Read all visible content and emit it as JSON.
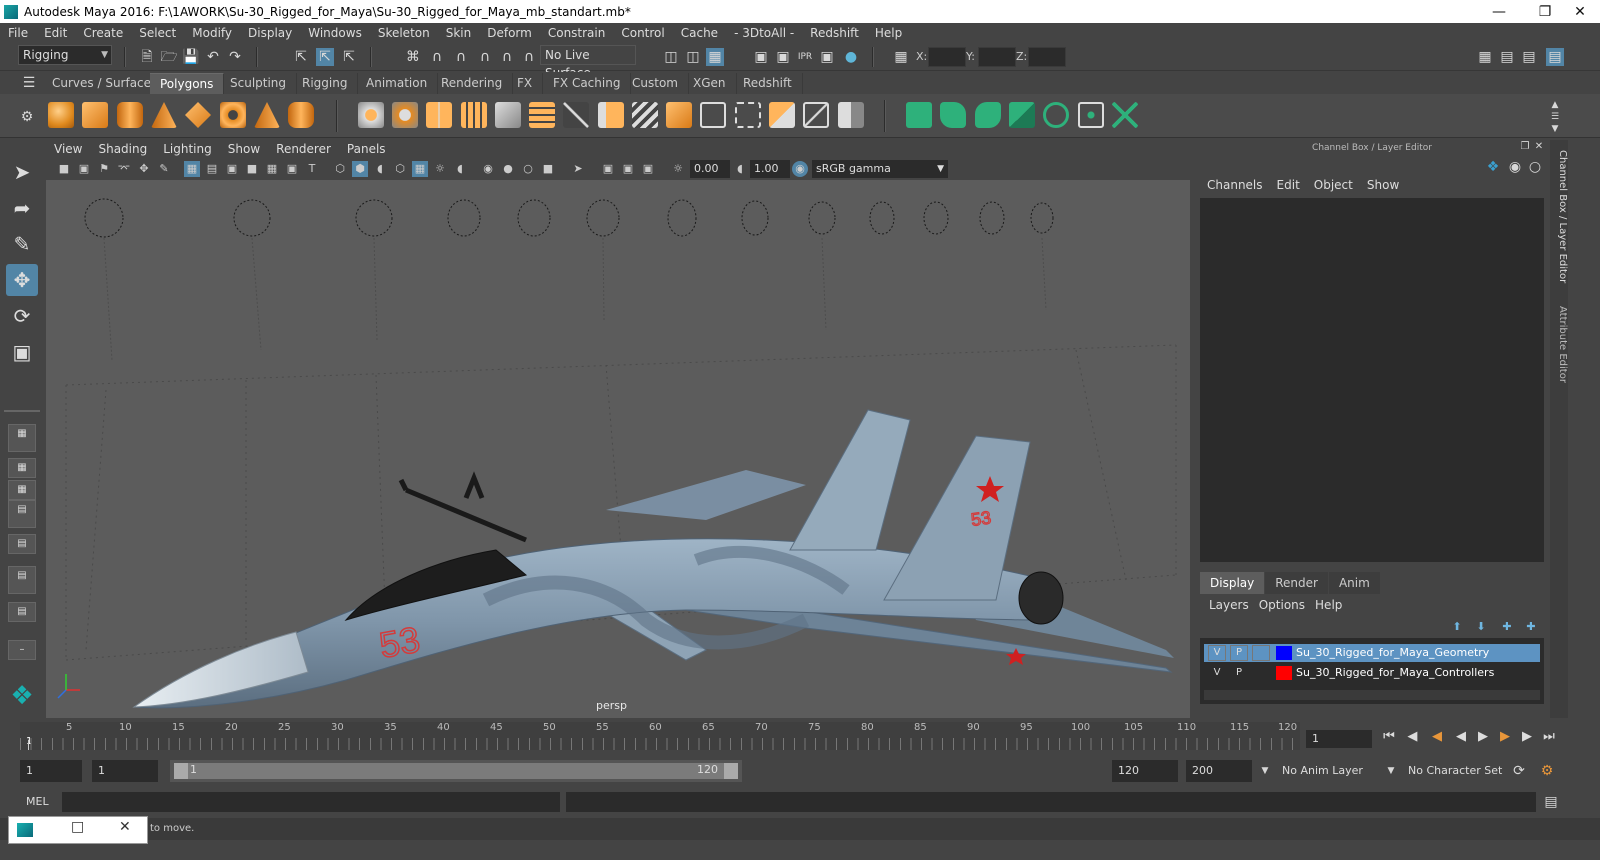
{
  "window": {
    "title": "Autodesk Maya 2016: F:\\1AWORK\\Su-30_Rigged_for_Maya\\Su-30_Rigged_for_Maya_mb_standart.mb*"
  },
  "menubar": [
    "File",
    "Edit",
    "Create",
    "Select",
    "Modify",
    "Display",
    "Windows",
    "Skeleton",
    "Skin",
    "Deform",
    "Constrain",
    "Control",
    "Cache",
    "- 3DtoAll -",
    "Redshift",
    "Help"
  ],
  "statusline": {
    "menuset": "Rigging",
    "live_surface": "No Live Surface",
    "x_label": "X:",
    "y_label": "Y:",
    "z_label": "Z:"
  },
  "shelf_tabs": [
    "Curves / Surfaces",
    "Polygons",
    "Sculpting",
    "Rigging",
    "Animation",
    "Rendering",
    "FX",
    "FX Caching",
    "Custom",
    "XGen",
    "Redshift"
  ],
  "shelf_active": "Polygons",
  "viewport": {
    "menu": [
      "View",
      "Shading",
      "Lighting",
      "Show",
      "Renderer",
      "Panels"
    ],
    "exposure": "0.00",
    "gamma": "1.00",
    "color_space": "sRGB gamma",
    "camera_label": "persp",
    "aircraft_number": "53"
  },
  "channel_box": {
    "title": "Channel Box / Layer Editor",
    "menu": [
      "Channels",
      "Edit",
      "Object",
      "Show"
    ]
  },
  "layer_editor": {
    "tabs": [
      "Display",
      "Render",
      "Anim"
    ],
    "active_tab": "Display",
    "menu": [
      "Layers",
      "Options",
      "Help"
    ],
    "layers": [
      {
        "v": "V",
        "p": "P",
        "color": "#0000ff",
        "name": "Su_30_Rigged_for_Maya_Geometry",
        "selected": true
      },
      {
        "v": "V",
        "p": "P",
        "color": "#ff0000",
        "name": "Su_30_Rigged_for_Maya_Controllers",
        "selected": false
      }
    ]
  },
  "side_tabs": [
    "Channel Box / Layer Editor",
    "Attribute Editor"
  ],
  "timeline": {
    "ticks": [
      "5",
      "10",
      "15",
      "20",
      "25",
      "30",
      "35",
      "40",
      "45",
      "50",
      "55",
      "60",
      "65",
      "70",
      "75",
      "80",
      "85",
      "90",
      "95",
      "100",
      "105",
      "110",
      "115",
      "120"
    ],
    "start_label": "1",
    "current_frame": "1"
  },
  "range": {
    "start": "1",
    "playback_start": "1",
    "slider_start": "1",
    "slider_end": "120",
    "playback_end": "120",
    "end": "200",
    "anim_layer": "No Anim Layer",
    "character_set": "No Character Set"
  },
  "cmdline": {
    "label": "MEL"
  },
  "helpline": {
    "text": "to move."
  }
}
